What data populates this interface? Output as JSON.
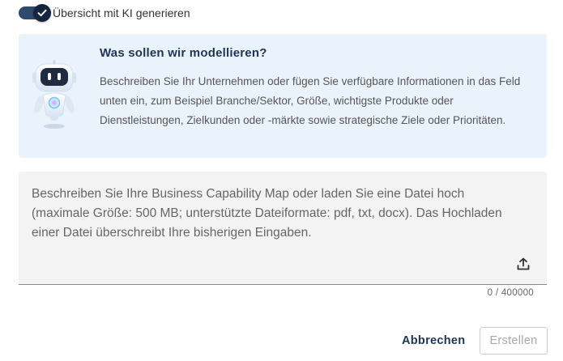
{
  "ai_toggle": {
    "label": "Übersicht mit KI generieren",
    "checked": true
  },
  "info": {
    "title": "Was sollen wir modellieren?",
    "text": "Beschreiben Sie Ihr Unternehmen oder fügen Sie verfügbare Informationen in das Feld unten ein, zum Beispiel Branche/Sektor, Größe, wichtigste Produkte oder Dienstleistungen, Zielkunden oder -märkte sowie strategische Ziele oder Prioritäten."
  },
  "description_field": {
    "placeholder": "Beschreiben Sie Ihre Business Capability Map oder laden Sie eine Datei hoch (maximale Größe: 500 MB; unterstützte Dateiformate: pdf, txt, docx). Das Hochladen einer Datei überschreibt Ihre bisherigen Eingaben.",
    "value": "",
    "counter": "0 / 400000"
  },
  "actions": {
    "cancel_label": "Abbrechen",
    "create_label": "Erstellen"
  },
  "colors": {
    "accent": "#1d3557",
    "panel_bg": "#eaf3fc",
    "field_bg": "#f3f3f3",
    "disabled_text": "#a8a8a8"
  },
  "icons": {
    "toggle": "checkmark-icon",
    "upload": "upload-icon",
    "mascot": "robot-icon"
  }
}
